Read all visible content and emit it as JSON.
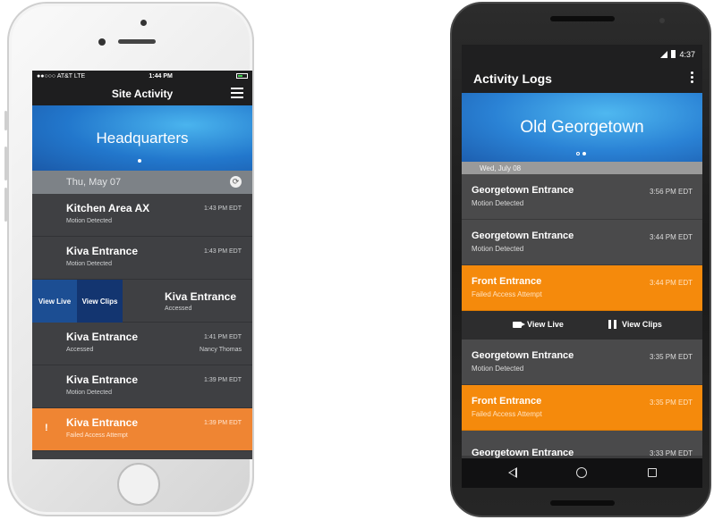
{
  "iphone": {
    "status": {
      "carrier": "●●○○○ AT&T  LTE",
      "time": "1:44 PM"
    },
    "nav": {
      "title": "Site Activity"
    },
    "banner": {
      "location": "Headquarters"
    },
    "date_header": "Thu, May 07",
    "swipe_actions": {
      "view_live": "View Live",
      "view_clips": "View Clips"
    },
    "events": [
      {
        "title": "Kitchen Area AX",
        "subtitle": "Motion Detected",
        "time": "1:43 PM EDT"
      },
      {
        "title": "Kiva Entrance",
        "subtitle": "Motion Detected",
        "time": "1:43 PM EDT"
      },
      {
        "title": "Kiva Entrance",
        "subtitle": "Accessed"
      },
      {
        "title": "Kiva Entrance",
        "subtitle": "Accessed",
        "time": "1:41 PM EDT",
        "user": "Nancy Thomas"
      },
      {
        "title": "Kiva Entrance",
        "subtitle": "Motion Detected",
        "time": "1:39 PM EDT"
      },
      {
        "title": "Kiva Entrance",
        "subtitle": "Failed Access Attempt",
        "time": "1:39 PM EDT",
        "alert_mark": "!"
      }
    ],
    "colors": {
      "alert": "#ef8533",
      "live": "#1c4e93",
      "clips": "#133570"
    }
  },
  "android": {
    "status": {
      "time": "4:37"
    },
    "appbar": {
      "title": "Activity Logs"
    },
    "banner": {
      "location": "Old Georgetown"
    },
    "date_header": "Wed, July 08",
    "actions": {
      "view_live": "View Live",
      "view_clips": "View Clips"
    },
    "events": [
      {
        "title": "Georgetown Entrance",
        "subtitle": "Motion Detected",
        "time": "3:56 PM EDT"
      },
      {
        "title": "Georgetown Entrance",
        "subtitle": "Motion Detected",
        "time": "3:44 PM EDT"
      },
      {
        "title": "Front Entrance",
        "subtitle": "Failed Access Attempt",
        "time": "3:44 PM EDT"
      },
      {
        "title": "Georgetown Entrance",
        "subtitle": "Motion Detected",
        "time": "3:35 PM EDT"
      },
      {
        "title": "Front Entrance",
        "subtitle": "Failed Access Attempt",
        "time": "3:35 PM EDT"
      },
      {
        "title": "Georgetown Entrance",
        "time": "3:33 PM EDT"
      }
    ],
    "colors": {
      "alert": "#f58a0c"
    }
  }
}
